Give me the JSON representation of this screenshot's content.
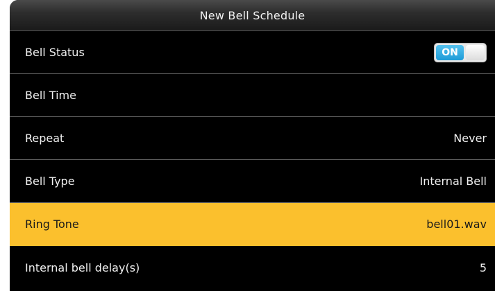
{
  "header": {
    "title": "New Bell Schedule"
  },
  "rows": [
    {
      "label": "Bell Status",
      "toggle": {
        "state": "on",
        "label": "ON",
        "color": "#1e9bd7"
      }
    },
    {
      "label": "Bell Time",
      "value": ""
    },
    {
      "label": "Repeat",
      "value": "Never"
    },
    {
      "label": "Bell Type",
      "value": "Internal Bell"
    },
    {
      "label": "Ring Tone",
      "value": "bell01.wav",
      "selected": true
    },
    {
      "label": "Internal bell delay(s)",
      "value": "5"
    }
  ],
  "colors": {
    "background": "#000000",
    "highlight": "#fbc02d",
    "divider": "#6e6e6e"
  }
}
